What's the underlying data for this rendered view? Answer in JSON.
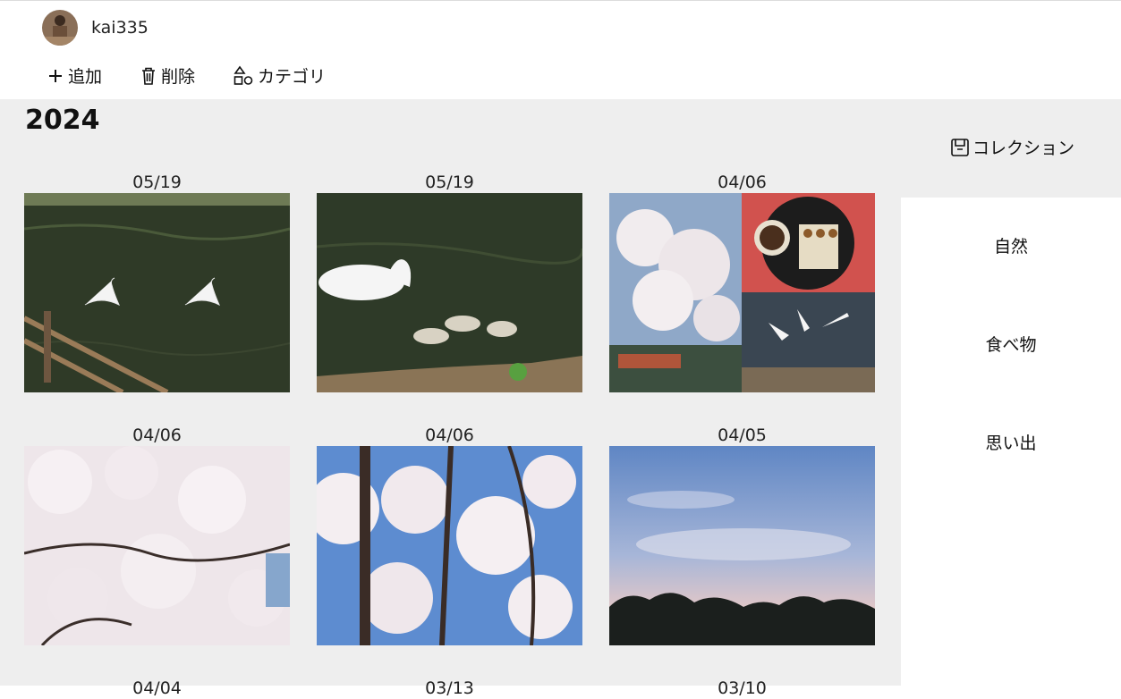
{
  "user": {
    "name": "kai335"
  },
  "toolbar": {
    "add_label": "追加",
    "delete_label": "削除",
    "category_label": "カテゴリ"
  },
  "gallery": {
    "year": "2024",
    "photos": [
      {
        "date": "05/19",
        "subject": "swans-on-pond"
      },
      {
        "date": "05/19",
        "subject": "swan-with-cygnets"
      },
      {
        "date": "04/06",
        "subject": "collage-blossoms-dango-swans"
      },
      {
        "date": "04/06",
        "subject": "cherry-blossoms"
      },
      {
        "date": "04/06",
        "subject": "cherry-blossoms-branches"
      },
      {
        "date": "04/05",
        "subject": "evening-sky"
      },
      {
        "date": "04/04"
      },
      {
        "date": "03/13"
      },
      {
        "date": "03/10"
      }
    ]
  },
  "sidebar": {
    "collection_label": "コレクション",
    "categories": [
      {
        "label": "自然"
      },
      {
        "label": "食べ物"
      },
      {
        "label": "思い出"
      }
    ]
  },
  "colors": {
    "panel_bg": "#eeeeee",
    "sidebar_bg": "#ffffff",
    "header_bg": "#ffffff"
  }
}
